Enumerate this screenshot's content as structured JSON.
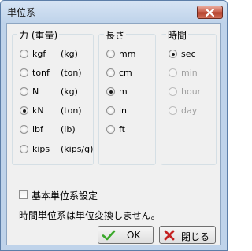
{
  "window": {
    "title": "単位系"
  },
  "groups": {
    "force": {
      "title": "力 (重量)",
      "options": [
        {
          "label": "kgf",
          "unit": "(kg)",
          "checked": false,
          "enabled": true
        },
        {
          "label": "tonf",
          "unit": "(ton)",
          "checked": false,
          "enabled": true
        },
        {
          "label": "N",
          "unit": "(kg)",
          "checked": false,
          "enabled": true
        },
        {
          "label": "kN",
          "unit": "(ton)",
          "checked": true,
          "enabled": true
        },
        {
          "label": "lbf",
          "unit": "(lb)",
          "checked": false,
          "enabled": true
        },
        {
          "label": "kips",
          "unit": "(kips/g)",
          "checked": false,
          "enabled": true
        }
      ]
    },
    "length": {
      "title": "長さ",
      "options": [
        {
          "label": "mm",
          "checked": false,
          "enabled": true
        },
        {
          "label": "cm",
          "checked": false,
          "enabled": true
        },
        {
          "label": "m",
          "checked": true,
          "enabled": true
        },
        {
          "label": "in",
          "checked": false,
          "enabled": true
        },
        {
          "label": "ft",
          "checked": false,
          "enabled": true
        }
      ]
    },
    "time": {
      "title": "時間",
      "options": [
        {
          "label": "sec",
          "checked": true,
          "enabled": true
        },
        {
          "label": "min",
          "checked": false,
          "enabled": false
        },
        {
          "label": "hour",
          "checked": false,
          "enabled": false
        },
        {
          "label": "day",
          "checked": false,
          "enabled": false
        }
      ]
    }
  },
  "checkbox": {
    "label": "基本単位系設定",
    "checked": false
  },
  "note": "時間単位系は単位変換しません。",
  "buttons": {
    "ok_label": "OK",
    "close_label": "閉じる"
  },
  "colors": {
    "frame": "#bfd3ea",
    "client": "#f0f0f0",
    "close_button": "#c75c48",
    "ok_icon": "#3aa82a",
    "close_icon": "#c42020"
  },
  "icons": {
    "window_close": "close-icon",
    "ok": "checkmark-icon",
    "close": "x-icon"
  }
}
